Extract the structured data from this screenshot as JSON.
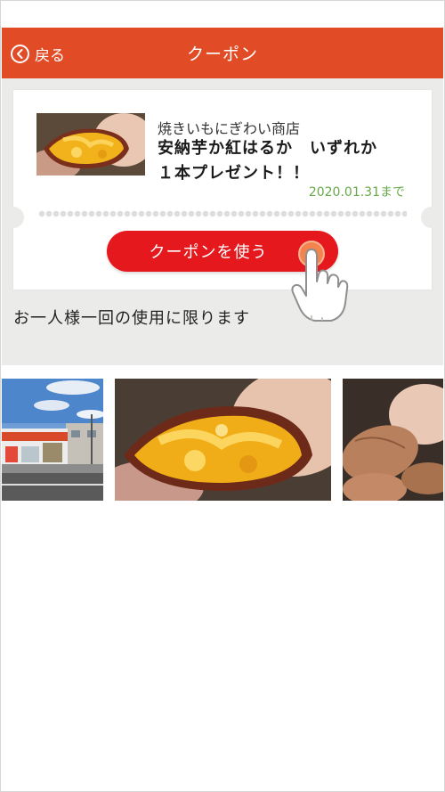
{
  "header": {
    "back_label": "戻る",
    "title": "クーポン"
  },
  "coupon": {
    "shop_name": "焼きいもにぎわい商店",
    "title_lines": [
      "安納芋か紅はるか　いずれか",
      "１本プレゼント！！"
    ],
    "expiry": "2020.01.31まで",
    "use_button_label": "クーポンを使う"
  },
  "notice": "お一人様一回の使用に限ります",
  "icons": {
    "back": "chevron-left-circle-icon",
    "hand": "pointing-hand-icon"
  },
  "colors": {
    "header_bg": "#e14b26",
    "button_bg": "#e5181e",
    "expiry_text": "#67a84a",
    "background_panel": "#ebebea"
  }
}
